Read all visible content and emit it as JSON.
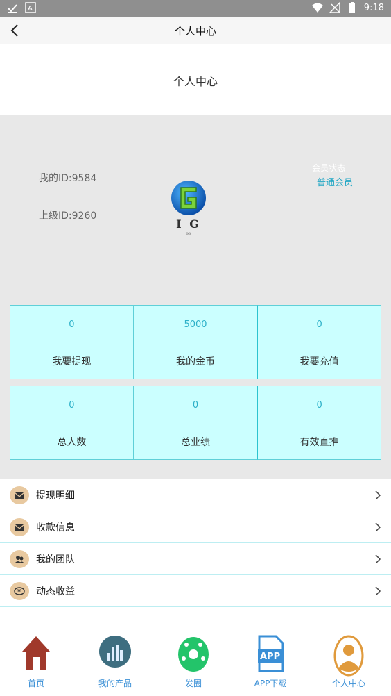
{
  "status_bar": {
    "time": "9:18"
  },
  "header": {
    "title": "个人中心"
  },
  "page_heading": "个人中心",
  "profile": {
    "my_id": "我的ID:9584",
    "parent_id": "上级ID:9260",
    "logo_text": "I G",
    "logo_sub": "IG",
    "member_status_label": "会员状态",
    "member_status_value": "普通会员"
  },
  "stats_row1": [
    {
      "value": "0",
      "label": "我要提现"
    },
    {
      "value": "5000",
      "label": "我的金币"
    },
    {
      "value": "0",
      "label": "我要充值"
    }
  ],
  "stats_row2": [
    {
      "value": "0",
      "label": "总人数"
    },
    {
      "value": "0",
      "label": "总业绩"
    },
    {
      "value": "0",
      "label": "有效直推"
    }
  ],
  "menu": [
    {
      "label": "提现明细",
      "icon": "envelope-icon"
    },
    {
      "label": "收款信息",
      "icon": "envelope-icon"
    },
    {
      "label": "我的团队",
      "icon": "team-icon"
    },
    {
      "label": "动态收益",
      "icon": "yen-icon"
    }
  ],
  "tabs": [
    {
      "label": "首页",
      "icon": "home-icon"
    },
    {
      "label": "我的产品",
      "icon": "products-icon"
    },
    {
      "label": "发圈",
      "icon": "moments-icon"
    },
    {
      "label": "APP下载",
      "icon": "app-download-icon"
    },
    {
      "label": "个人中心",
      "icon": "profile-icon"
    }
  ],
  "colors": {
    "accent": "#2cb0c8",
    "cell_bg": "#cbffff",
    "tab_label": "#3a8fd6",
    "home_icon": "#a0392b",
    "products_icon": "#3e6e80",
    "moments_icon": "#23c46a",
    "app_icon": "#3a8fd6",
    "profile_icon": "#e09a3c"
  }
}
